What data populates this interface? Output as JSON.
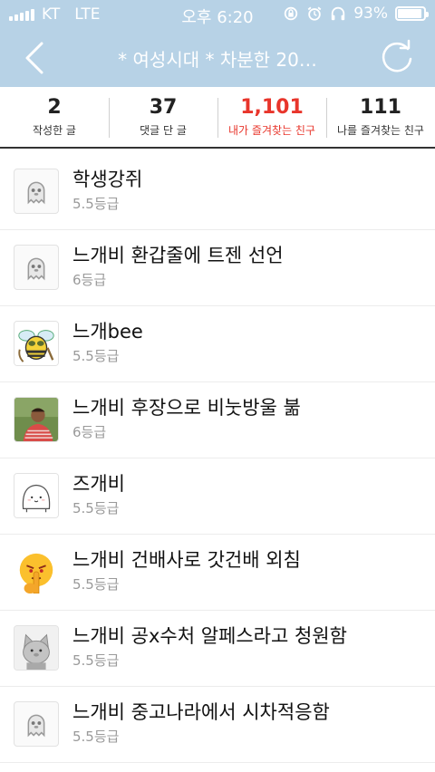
{
  "status_bar": {
    "carrier": "KT",
    "network": "LTE",
    "time": "오후 6:20",
    "battery": "93%",
    "battery_level": 0.93
  },
  "nav": {
    "title": "* 여성시대 *  차분한 20…"
  },
  "stats": [
    {
      "value": "2",
      "label": "작성한 글"
    },
    {
      "value": "37",
      "label": "댓글 단 글"
    },
    {
      "value": "1,101",
      "label": "내가 즐겨찾는 친구"
    },
    {
      "value": "111",
      "label": "나를 즐겨찾는 친구"
    }
  ],
  "members": [
    {
      "name": "학생강쥐",
      "grade": "5.5등급",
      "avatar": "default-ghost-icon"
    },
    {
      "name": "느개비 환갑줄에 트젠 선언",
      "grade": "6등급",
      "avatar": "default-ghost-icon"
    },
    {
      "name": "느개bee",
      "grade": "5.5등급",
      "avatar": "bee-icon"
    },
    {
      "name": "느개비 후장으로 비눗방울 붊",
      "grade": "6등급",
      "avatar": "photo-person"
    },
    {
      "name": "즈개비",
      "grade": "5.5등급",
      "avatar": "white-blob-icon"
    },
    {
      "name": "느개비 건배사로 갓건배 외침",
      "grade": "5.5등급",
      "avatar": "shush-emoji-icon"
    },
    {
      "name": "느개비 공x수처 알페스라고 청원함",
      "grade": "5.5등급",
      "avatar": "gray-cat-icon"
    },
    {
      "name": "느개비 중고나라에서 시차적응함",
      "grade": "5.5등급",
      "avatar": "default-ghost-icon"
    }
  ],
  "colors": {
    "header": "#b7d2e6",
    "active": "#e8352b"
  }
}
